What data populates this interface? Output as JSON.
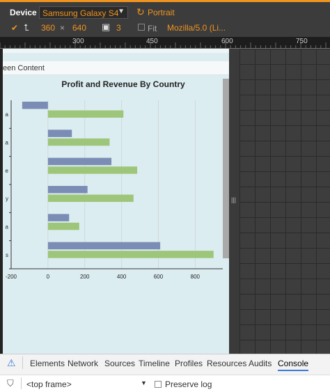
{
  "device_bar": {
    "device_label": "Device",
    "device_value": "Samsung Galaxy S4",
    "orientation_label": "Portrait",
    "width": "360",
    "times": "×",
    "height": "640",
    "dpr": "3",
    "fit_label": "Fit",
    "ua_value": "Mozilla/5.0 (Li..."
  },
  "ruler": {
    "ticks": [
      "300",
      "450",
      "600",
      "750"
    ]
  },
  "page": {
    "header_fragment": "een Content",
    "scroll_handle": "|||"
  },
  "chart_data": {
    "type": "bar",
    "title": "Profit and Revenue By Country",
    "categories": [
      "a",
      "a",
      "e",
      "y",
      "a",
      "s"
    ],
    "series": [
      {
        "color": "#7b8db5",
        "values": [
          -140,
          130,
          345,
          215,
          115,
          610
        ]
      },
      {
        "color": "#9dc67a",
        "values": [
          410,
          335,
          485,
          465,
          170,
          900
        ]
      }
    ],
    "xticks": [
      "-200",
      "0",
      "200",
      "400",
      "600",
      "800"
    ],
    "xlim": [
      -200,
      950
    ]
  },
  "devtools": {
    "tabs": [
      "Elements",
      "Network",
      "Sources",
      "Timeline",
      "Profiles",
      "Resources",
      "Audits",
      "Console"
    ],
    "active_tab": "Console",
    "frame_value": "<top frame>",
    "preserve_log_label": "Preserve log"
  },
  "icons": {
    "check": "✔",
    "rotate": "↻",
    "swap": "⮤",
    "screen": "▣",
    "filter": "⛉",
    "warning": "⚠"
  }
}
